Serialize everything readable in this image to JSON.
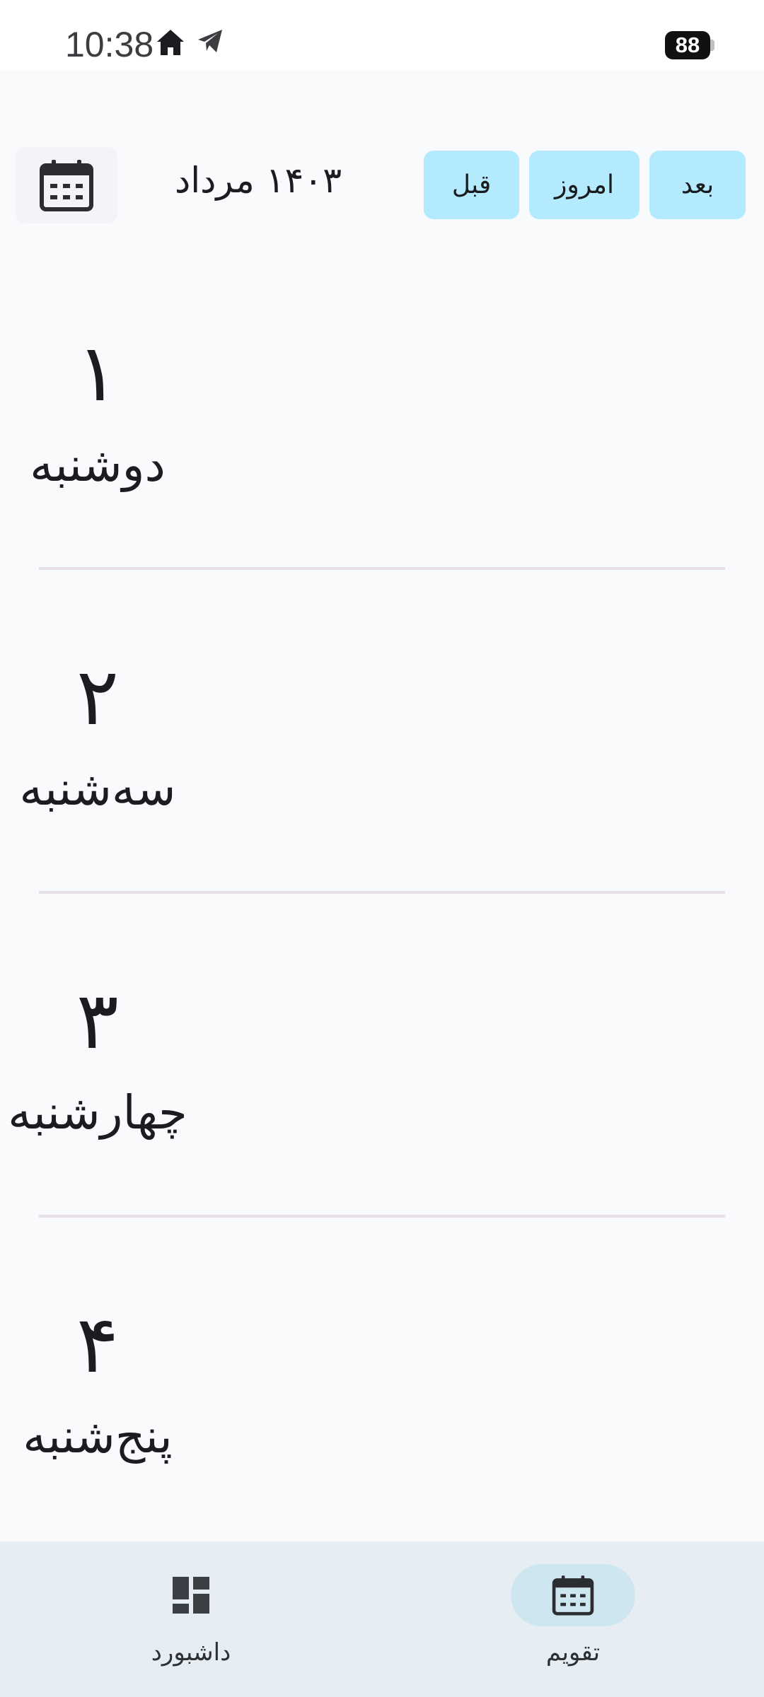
{
  "status_bar": {
    "time": "10:38",
    "battery": "88",
    "icons": [
      "home-icon",
      "telegram-icon"
    ]
  },
  "header": {
    "calendar_icon": "calendar-icon",
    "month_title": "۱۴۰۳ مرداد",
    "prev_label": "قبل",
    "today_label": "امروز",
    "next_label": "بعد"
  },
  "days": [
    {
      "number": "۱",
      "name": "دوشنبه"
    },
    {
      "number": "۲",
      "name": "سه‌شنبه"
    },
    {
      "number": "۳",
      "name": "چهارشنبه"
    },
    {
      "number": "۴",
      "name": "پنج‌شنبه"
    }
  ],
  "bottom_nav": {
    "items": [
      {
        "label": "داشبورد",
        "icon": "dashboard-icon",
        "active": false
      },
      {
        "label": "تقویم",
        "icon": "calendar-icon",
        "active": true
      }
    ]
  },
  "colors": {
    "background": "#f9fafc",
    "button": "#b3eafd",
    "nav_background": "#e6edf3",
    "nav_active_pill": "#cde6ef"
  }
}
